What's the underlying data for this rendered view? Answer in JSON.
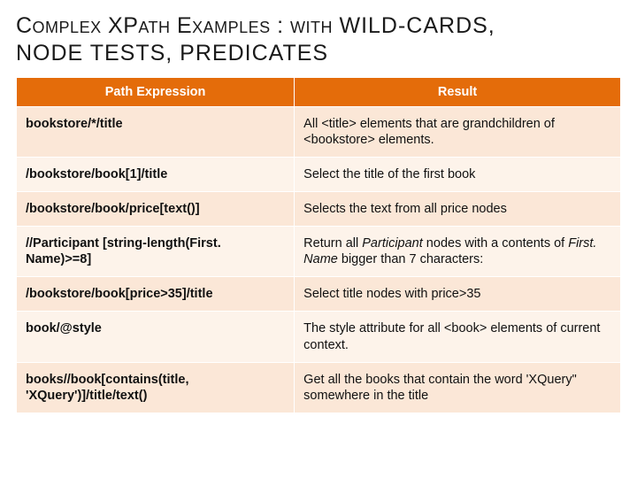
{
  "title": {
    "line1_sc": "Complex XPath Examples : with ",
    "line1_tail": "WILD-CARDS,",
    "line2": "NODE TESTS, PREDICATES"
  },
  "table": {
    "headers": {
      "expr": "Path Expression",
      "result": "Result"
    },
    "rows": [
      {
        "expr": "bookstore/*/title",
        "result": "All <title> elements that are grandchildren of <bookstore> elements."
      },
      {
        "expr": "/bookstore/book[1]/title",
        "result": "Select the title of the first book"
      },
      {
        "expr": "/bookstore/book/price[text()]",
        "result": "Selects the text from all price nodes"
      },
      {
        "expr": "//Participant [string-length(First. Name)>=8]",
        "result_pre": "Return all ",
        "result_em1": "Participant",
        "result_mid": " nodes with a contents of ",
        "result_em2": "First. Name",
        "result_post": " bigger than 7 characters:"
      },
      {
        "expr": "/bookstore/book[price>35]/title",
        "result": "Select title nodes with price>35"
      },
      {
        "expr": "book/@style",
        "result": "The style attribute for all <book> elements of current context."
      },
      {
        "expr": "books//book[contains(title, 'XQuery')]/title/text()",
        "result": "Get all the books that contain the word 'XQuery\" somewhere in the title"
      }
    ]
  }
}
